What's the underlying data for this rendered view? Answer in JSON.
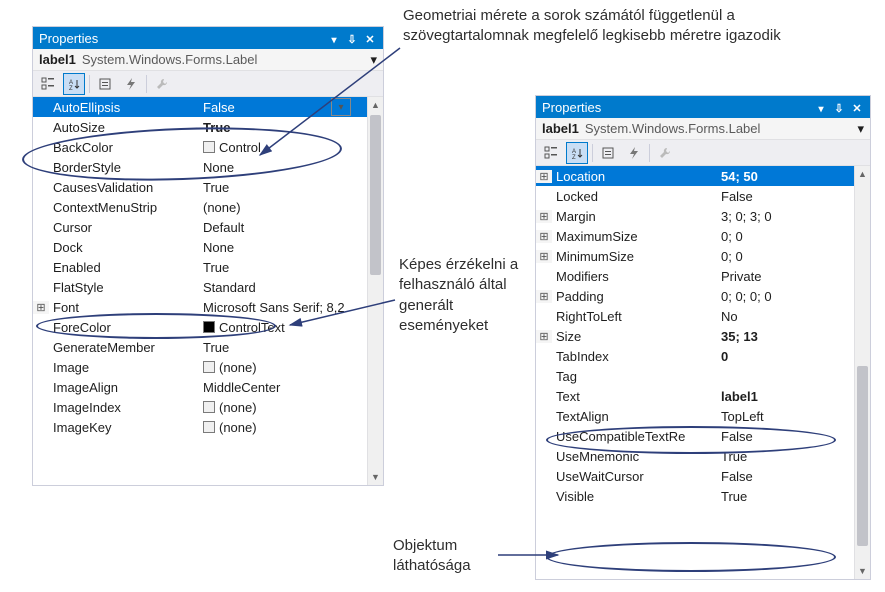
{
  "annotations": {
    "top": "Geometriai mérete a sorok számától függetlenül a szövegtartalomnak megfelelő legkisebb méretre igazodik",
    "middle": "Képes érzékelni a felhasználó által generált eseményeket",
    "bottom": "Objektum láthatósága"
  },
  "left_panel": {
    "title": "Properties",
    "object": "label1",
    "type": "System.Windows.Forms.Label",
    "name_col_width": 150,
    "rows": [
      {
        "name": "AutoEllipsis",
        "value": "False",
        "selected": true,
        "dropdown": true
      },
      {
        "name": "AutoSize",
        "value": "True",
        "bold": true
      },
      {
        "name": "BackColor",
        "value": "Control",
        "swatch": "control"
      },
      {
        "name": "BorderStyle",
        "value": "None"
      },
      {
        "name": "CausesValidation",
        "value": "True"
      },
      {
        "name": "ContextMenuStrip",
        "value": "(none)"
      },
      {
        "name": "Cursor",
        "value": "Default"
      },
      {
        "name": "Dock",
        "value": "None"
      },
      {
        "name": "Enabled",
        "value": "True"
      },
      {
        "name": "FlatStyle",
        "value": "Standard"
      },
      {
        "name": "Font",
        "value": "Microsoft Sans Serif; 8,2",
        "expand": true
      },
      {
        "name": "ForeColor",
        "value": "ControlText",
        "swatch": "black"
      },
      {
        "name": "GenerateMember",
        "value": "True"
      },
      {
        "name": "Image",
        "value": "(none)",
        "swatch": "control"
      },
      {
        "name": "ImageAlign",
        "value": "MiddleCenter"
      },
      {
        "name": "ImageIndex",
        "value": "(none)",
        "swatch": "control"
      },
      {
        "name": "ImageKey",
        "value": "(none)",
        "swatch": "control"
      }
    ]
  },
  "right_panel": {
    "title": "Properties",
    "object": "label1",
    "type": "System.Windows.Forms.Label",
    "name_col_width": 165,
    "rows": [
      {
        "name": "Location",
        "value": "54; 50",
        "selected": true,
        "bold": true,
        "expand": true
      },
      {
        "name": "Locked",
        "value": "False"
      },
      {
        "name": "Margin",
        "value": "3; 0; 3; 0",
        "expand": true
      },
      {
        "name": "MaximumSize",
        "value": "0; 0",
        "expand": true
      },
      {
        "name": "MinimumSize",
        "value": "0; 0",
        "expand": true
      },
      {
        "name": "Modifiers",
        "value": "Private"
      },
      {
        "name": "Padding",
        "value": "0; 0; 0; 0",
        "expand": true
      },
      {
        "name": "RightToLeft",
        "value": "No"
      },
      {
        "name": "Size",
        "value": "35; 13",
        "bold": true,
        "expand": true
      },
      {
        "name": "TabIndex",
        "value": "0",
        "bold": true
      },
      {
        "name": "Tag",
        "value": ""
      },
      {
        "name": "Text",
        "value": "label1",
        "bold": true
      },
      {
        "name": "TextAlign",
        "value": "TopLeft"
      },
      {
        "name": "UseCompatibleTextRe",
        "value": "False"
      },
      {
        "name": "UseMnemonic",
        "value": "True"
      },
      {
        "name": "UseWaitCursor",
        "value": "False"
      },
      {
        "name": "Visible",
        "value": "True"
      }
    ]
  }
}
